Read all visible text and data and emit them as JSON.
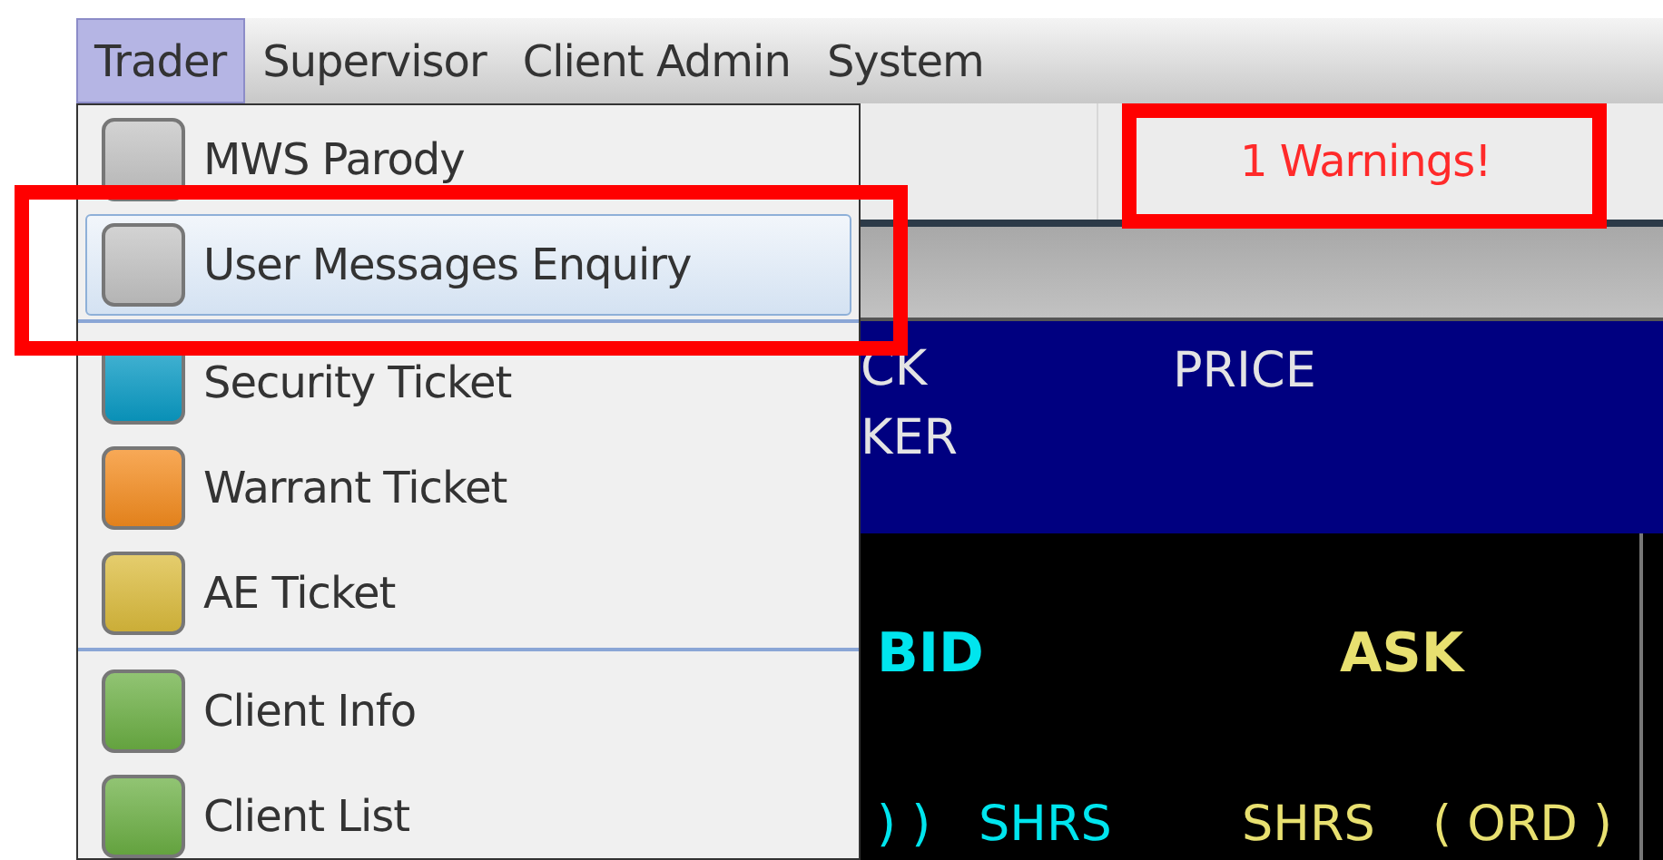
{
  "menubar": {
    "items": [
      {
        "label": "Trader",
        "selected": true
      },
      {
        "label": "Supervisor",
        "selected": false
      },
      {
        "label": "Client Admin",
        "selected": false
      },
      {
        "label": "System",
        "selected": false
      }
    ]
  },
  "dropdown": {
    "items": [
      {
        "label": "MWS Parody",
        "color": "#c4c4c4",
        "selected": false,
        "separator_after": false
      },
      {
        "label": "User Messages Enquiry",
        "color": "#c4c4c4",
        "selected": true,
        "separator_after": true
      },
      {
        "label": "Security Ticket",
        "color": "#0a9cc6",
        "selected": false,
        "separator_after": false
      },
      {
        "label": "Warrant Ticket",
        "color": "#f58c1e",
        "selected": false,
        "separator_after": false
      },
      {
        "label": "AE Ticket",
        "color": "#dcbc3c",
        "selected": false,
        "separator_after": true
      },
      {
        "label": "Client Info",
        "color": "#6cb044",
        "selected": false,
        "separator_after": false
      },
      {
        "label": "Client List",
        "color": "#6cb044",
        "selected": false,
        "separator_after": false
      }
    ]
  },
  "toolbar": {
    "warning": "1 Warnings!"
  },
  "quote_header": {
    "stock_label_lines": [
      "CK",
      "KER"
    ],
    "price_label": "PRICE"
  },
  "quote_board": {
    "bid_label": "BID",
    "ask_label": "ASK",
    "columns": [
      {
        "label": ") )",
        "color": "#00e5ee"
      },
      {
        "label": "SHRS",
        "color": "#00e5ee"
      },
      {
        "label": "SHRS",
        "color": "#e8e070"
      },
      {
        "label": "( ORD )",
        "color": "#e8e070"
      }
    ]
  }
}
